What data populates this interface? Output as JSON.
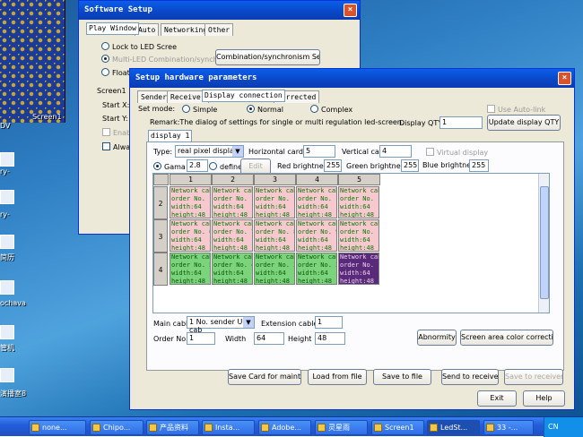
{
  "desktop": {
    "preview_label": "Screen1",
    "icons": [
      "DV",
      "ry-",
      "ry-",
      "简历",
      "ochava",
      "管机",
      "演播室8"
    ]
  },
  "software_setup": {
    "title": "Software Setup",
    "tabs": [
      "Play Window",
      "Auto",
      "Networking",
      "Other"
    ],
    "lock_label": "Lock to LED Scree",
    "multi_label": "Multi-LED Combination/synchronism",
    "combo_button": "Combination/synchronism Setting",
    "float_label": "Floati",
    "screen_label": "Screen1",
    "start_x": "Start X:",
    "start_y": "Start Y:",
    "enable_label": "Enabl",
    "always_label": "Alway"
  },
  "hw": {
    "title": "Setup hardware parameters",
    "close": "×",
    "tabs": [
      "Sender",
      "Receiver",
      "Display connection",
      "Corrected"
    ],
    "set_mode_label": "Set mode:",
    "modes": [
      "Simple",
      "Normal",
      "Complex"
    ],
    "use_autolink": "Use Auto-link",
    "remark": "Remark:The dialog of settings for single or multi  regulation led-screen.",
    "display_qty_label": "Display QTY:",
    "display_qty": "1",
    "update_button": "Update display QTY",
    "display_tab": "display 1",
    "type_label": "Type:",
    "type_value": "real pixel display",
    "hcard_label": "Horizontal card",
    "hcard": "5",
    "vcard_label": "Vertical card",
    "vcard": "4",
    "virtual_label": "Virtual display",
    "gama_label": "Gama",
    "gama": "2.8",
    "define_label": "define",
    "edit_button": "Edit",
    "red_label": "Red brightness",
    "red": "255",
    "green_label": "Green brightness",
    "green": "255",
    "blue_label": "Blue brightness",
    "blue": "255",
    "main_cable_label": "Main cable",
    "main_cable": "1 No. sender U cab",
    "ext_cable_label": "Extension cable",
    "ext_cable": "1",
    "order_label": "Order No.",
    "order": "1",
    "width_label": "Width",
    "width": "64",
    "height_label": "Height",
    "height": "48",
    "abnormity_button": "Abnormity",
    "color_correction_button": "Screen area color correction",
    "save_card_button": "Save Card for maintain",
    "load_button": "Load from file",
    "save_file_button": "Save to file",
    "send_button": "Send to receiver",
    "save_receiver_button": "Save to receiver",
    "exit_button": "Exit",
    "help_button": "Help"
  },
  "grid": {
    "columns": [
      "1",
      "2",
      "3",
      "4",
      "5"
    ],
    "rows": [
      {
        "id": "2",
        "cells": [
          "Network cab\norder No. 1\nwidth:64\nheight:48",
          "Network cab\norder No. 1\nwidth:64\nheight:48",
          "Network cab\norder No. 1\nwidth:64\nheight:48",
          "Network cab\norder No. 1\nwidth:64\nheight:48",
          "Network cab\norder No. 1\nwidth:64\nheight:48"
        ]
      },
      {
        "id": "3",
        "cells": [
          "Network cab\norder No. 6\nwidth:64\nheight:48",
          "Network cab\norder No. 7\nwidth:64\nheight:48",
          "Network cab\norder No. 8\nwidth:64\nheight:48",
          "Network cab\norder No. 9\nwidth:64\nheight:48",
          "Network cab\norder No. 1\nwidth:64\nheight:48"
        ]
      },
      {
        "id": "4",
        "cells": [
          "Network cab\norder No. 5\nwidth:64\nheight:48",
          "Network cab\norder No. 4\nwidth:64\nheight:48",
          "Network cab\norder No. 3\nwidth:64\nheight:48",
          "Network cab\norder No. 2\nwidth:64\nheight:48",
          "Network cab\norder No. 1\nwidth:64\nheight:48"
        ]
      }
    ]
  },
  "taskbar": {
    "items": [
      "none...",
      "Chipo...",
      "产品资料",
      "Insta...",
      "Adobe...",
      "灵星雨",
      "Screen1",
      "LedSt...",
      "33 -..."
    ],
    "tray": "CN"
  }
}
